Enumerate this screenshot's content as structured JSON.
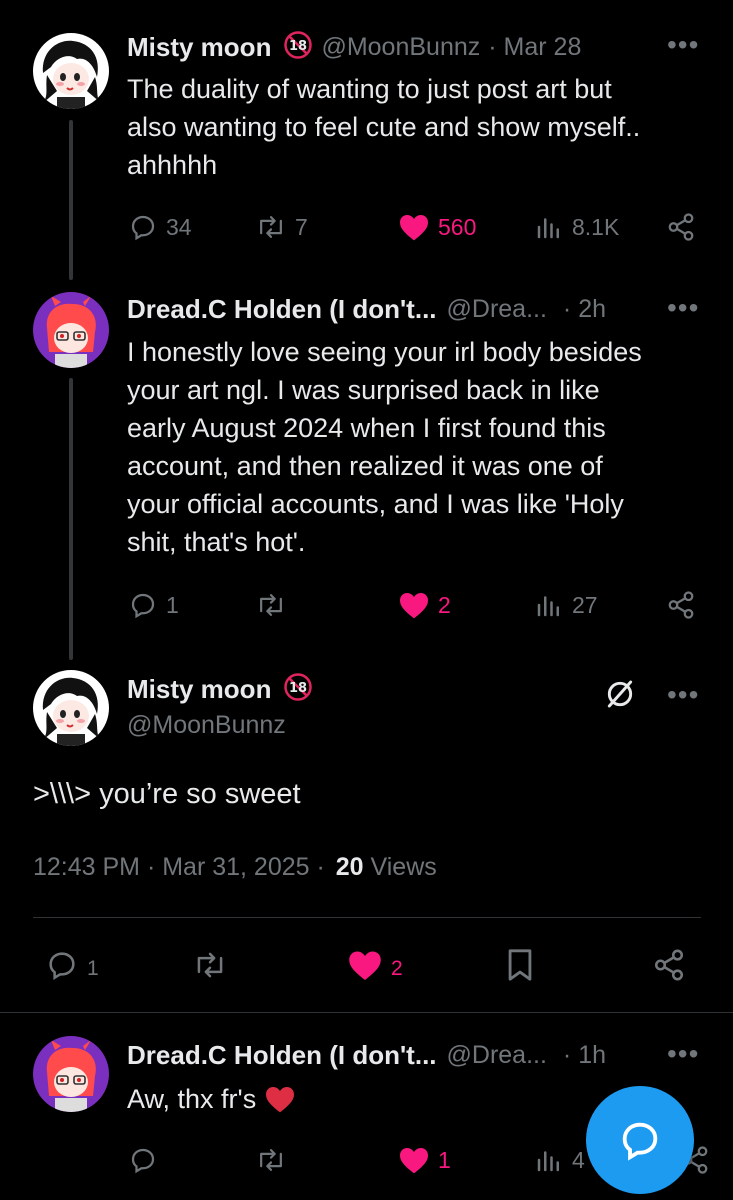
{
  "colors": {
    "background": "#000000",
    "text": "#e7e9ea",
    "muted": "#71767b",
    "like": "#f91880",
    "accent": "#1d9bf0",
    "divider": "#2f3336"
  },
  "tweets": [
    {
      "name": "Misty moon",
      "handle": "@MoonBunnz",
      "time": "· Mar 28",
      "text": [
        "The duality of wanting to just post art but",
        "also wanting to feel cute and show myself..",
        "ahhhhh"
      ],
      "replies": "34",
      "reposts": "7",
      "likes": "560",
      "views": "8.1K"
    },
    {
      "name": "Dread.C Holden (I don't...",
      "handle": "@Drea...",
      "time": "· 2h",
      "text": [
        "I honestly love seeing your irl body besides",
        "your art ngl. I was surprised back in like",
        "early August 2024 when I first found this",
        "account, and then realized it was one of",
        "your official accounts, and I was like 'Holy",
        "shit, that's hot'."
      ],
      "replies": "1",
      "reposts": "",
      "likes": "2",
      "views": "27"
    }
  ],
  "main_tweet": {
    "name": "Misty moon",
    "handle": "@MoonBunnz",
    "text": ">\\\\\\> you’re so sweet",
    "timestamp": "12:43 PM · Mar 31, 2025 ·",
    "views_count": "20",
    "views_label": "Views",
    "replies": "1",
    "likes": "2"
  },
  "reply": {
    "name": "Dread.C Holden (I don't...",
    "handle": "@Drea...",
    "time": "· 1h",
    "text": "Aw, thx fr's",
    "likes": "1",
    "views": "4"
  },
  "icons": [
    "reply-icon",
    "repost-icon",
    "heart-icon",
    "views-icon",
    "share-icon",
    "bookmark-icon",
    "grok-icon",
    "compose-icon",
    "more-icon",
    "age-18-icon"
  ]
}
